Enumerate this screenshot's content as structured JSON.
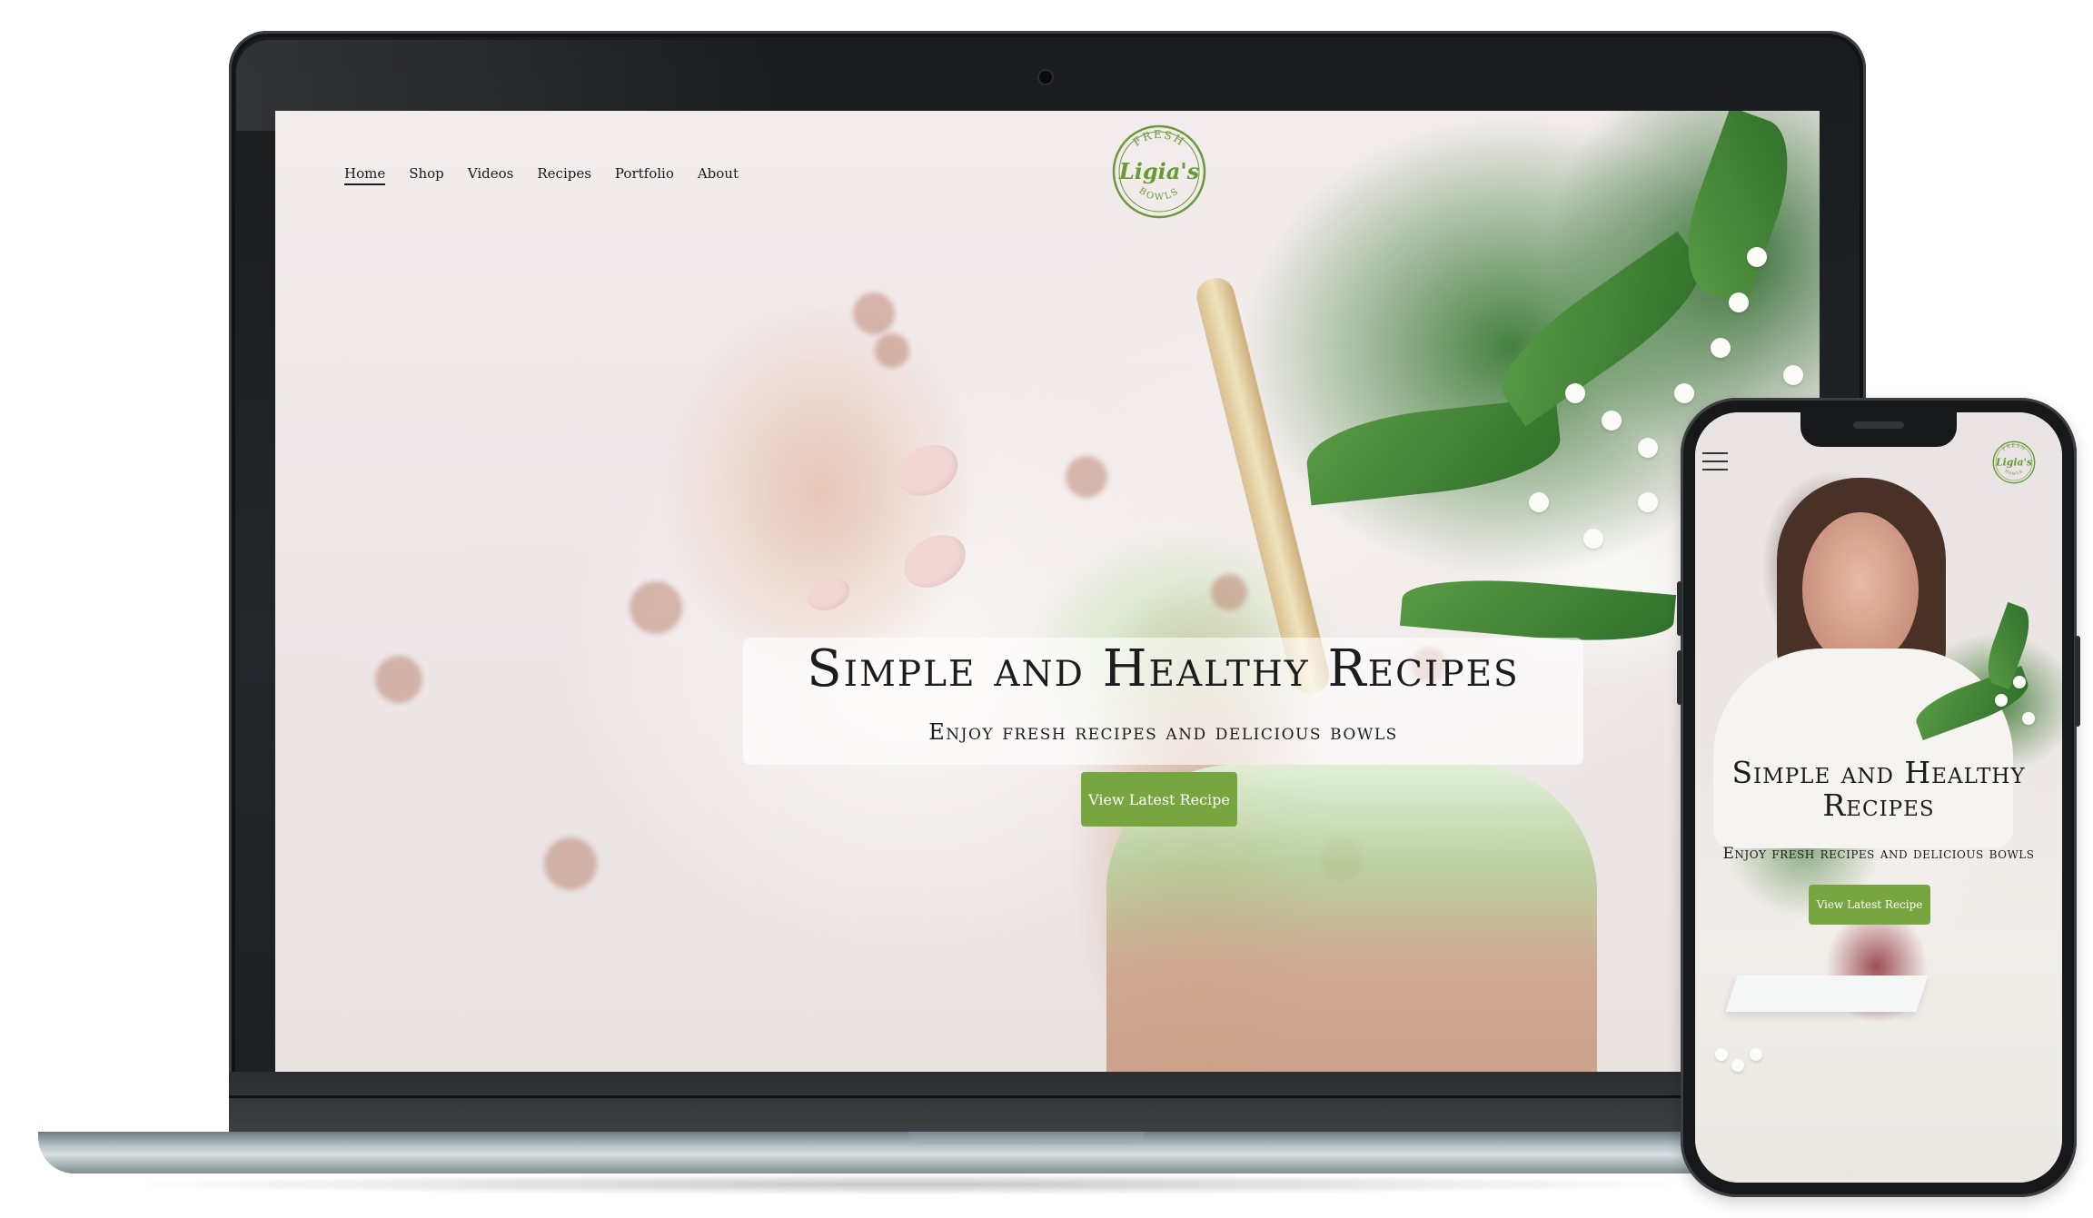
{
  "desktop": {
    "nav": {
      "items": [
        "Home",
        "Shop",
        "Videos",
        "Recipes",
        "Portfolio",
        "About"
      ],
      "active": "Home"
    },
    "logo": {
      "script_text": "Ligia's",
      "arc_top": "FRESH",
      "arc_bottom": "BOWLS"
    },
    "hero": {
      "title": "Simple and Healthy Recipes",
      "subtitle": "Enjoy fresh recipes and delicious bowls",
      "cta_label": "View Latest Recipe"
    }
  },
  "mobile": {
    "logo": {
      "script_text": "Ligia's",
      "arc_top": "FRESH",
      "arc_bottom": "BOWLS"
    },
    "hero": {
      "title": "Simple and Healthy Recipes",
      "subtitle": "Enjoy fresh recipes and delicious bowls",
      "cta_label": "View Latest Recipe"
    }
  },
  "colors": {
    "brand_green": "#77a640",
    "logo_green": "#6a9a36",
    "text_dark": "#1c1c1c",
    "device_frame": "#1d2022"
  },
  "icons": [
    "menu-icon",
    "logo-icon"
  ]
}
